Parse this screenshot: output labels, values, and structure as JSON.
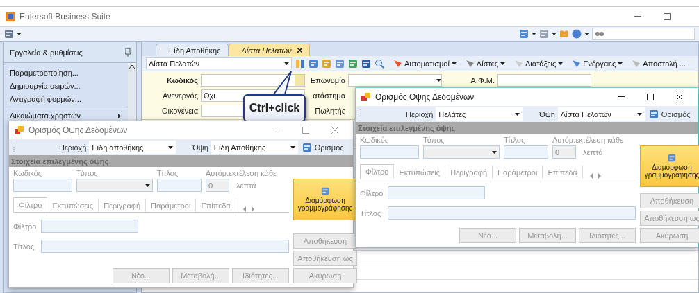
{
  "window": {
    "title": "Entersoft Business Suite"
  },
  "sidebar": {
    "title": "Εργαλεία & ρυθμίσεις",
    "items": [
      {
        "label": "Παραμετροποίηση...",
        "kind": "action"
      },
      {
        "label": "Δημιουργία σειρών...",
        "kind": "action"
      },
      {
        "label": "Αντιγραφή φορμών...",
        "kind": "action"
      },
      {
        "label": "Δικαιώματα χρηστών",
        "kind": "submenu"
      }
    ]
  },
  "tabs": [
    {
      "label": "Είδη Αποθήκης",
      "selected": false
    },
    {
      "label": "Λίστα Πελατών",
      "selected": true
    }
  ],
  "toolbar": {
    "view": "Λίστα Πελατών",
    "menus": [
      "Αυτοματισμοί",
      "Λίστες",
      "Διατάξεις",
      "Ενέργειες",
      "Αποστολή ..."
    ]
  },
  "form": {
    "rows": [
      {
        "fields": [
          {
            "label": "Κωδικός",
            "bold": true,
            "kind": "lookup"
          },
          {
            "label": "Επωνυμία",
            "bold": false,
            "kind": "combo"
          },
          {
            "label": "Α.Φ.Μ.",
            "bold": false,
            "kind": "text"
          }
        ]
      },
      {
        "fields": [
          {
            "label": "Ανενεργός",
            "bold": false,
            "kind": "text",
            "value": "Όχι"
          },
          {
            "label": "ατάστημα",
            "bold": false,
            "kind": "label"
          }
        ]
      },
      {
        "fields": [
          {
            "label": "Οικογένεια",
            "bold": false,
            "kind": "text"
          },
          {
            "label": "Πωλητής",
            "bold": false,
            "kind": "label"
          }
        ]
      }
    ]
  },
  "callout": {
    "text": "Ctrl+click"
  },
  "dialogs": [
    {
      "title": "Ορισμός Οψης Δεδομένων",
      "active": false,
      "area_label": "Περιοχή",
      "area": "Ειδη αποθήκης",
      "view_label": "Όψη",
      "view": "Είδη Αποθήκης",
      "define": "Ορισμός",
      "section": "Στοιχεία επιλεγμένης όψης",
      "code_label": "Κωδικός",
      "type_label": "Τύπος",
      "title_label": "Τίτλος",
      "auto_label": "Αυτόμ.εκτέλεση κάθε",
      "auto_value": "0",
      "minutes": "λεπτά",
      "design": "Διαμόρφωση γραμμογράφησης",
      "tabs": [
        {
          "label": "Φίλτρο",
          "selected": true
        },
        {
          "label": "Εκτυπώσεις",
          "selected": false
        },
        {
          "label": "Περιγραφή",
          "selected": false
        },
        {
          "label": "Παράμετροι",
          "selected": false
        },
        {
          "label": "Επίπεδα",
          "selected": false
        }
      ],
      "filter_label": "Φίλτρο",
      "name_label": "Τίτλος",
      "actions": [
        "Νέο...",
        "Μεταβολή...",
        "Ιδιότητες..."
      ],
      "buttons": [
        "Αποθήκευση",
        "Αποθήκευση ως",
        "Ακύρωση"
      ]
    },
    {
      "title": "Ορισμός Οψης Δεδομένων",
      "active": true,
      "area_label": "Περιοχή",
      "area": "Πελάτες",
      "view_label": "Όψη",
      "view": "Λίστα Πελατών",
      "define": "Ορισμός",
      "section": "Στοιχεία επιλεγμένης όψης",
      "code_label": "Κωδικός",
      "type_label": "Τύπος",
      "title_label": "Τίτλος",
      "auto_label": "Αυτόμ.εκτέλεση κάθε",
      "auto_value": "0",
      "minutes": "λεπτά",
      "design": "Διαμόρφωση γραμμογράφησης",
      "tabs": [
        {
          "label": "Φίλτρο",
          "selected": true
        },
        {
          "label": "Εκτυπώσεις",
          "selected": false
        },
        {
          "label": "Περιγραφή",
          "selected": false
        },
        {
          "label": "Παράμετροι",
          "selected": false
        },
        {
          "label": "Επίπεδα",
          "selected": false
        }
      ],
      "filter_label": "Φίλτρο",
      "name_label": "Τίτλος",
      "actions": [
        "Νέο...",
        "Μεταβολή...",
        "Ιδιότητες..."
      ],
      "buttons": [
        "Αποθήκευση",
        "Αποθήκευση ως",
        "Ακύρωση"
      ]
    }
  ]
}
